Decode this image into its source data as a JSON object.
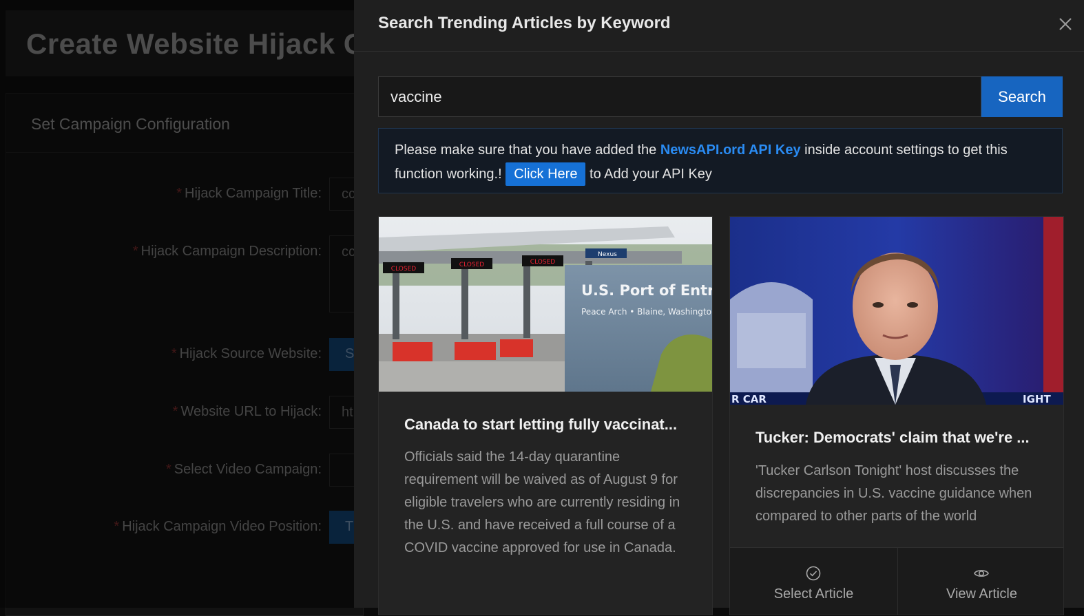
{
  "background": {
    "page_title": "Create Website Hijack Ca",
    "card_title": "Set Campaign Configuration",
    "fields": [
      {
        "label": "Hijack Campaign Title",
        "value": "cc"
      },
      {
        "label": "Hijack Campaign Description",
        "value": "cc"
      },
      {
        "label": "Hijack Source Website",
        "value": "S"
      },
      {
        "label": "Website URL to Hijack",
        "value": "ht"
      },
      {
        "label": "Select Video Campaign",
        "value": ""
      },
      {
        "label": "Hijack Campaign Video Position",
        "value": "T"
      }
    ],
    "required_mark": "*",
    "label_suffix": ":"
  },
  "drawer": {
    "title": "Search Trending Articles by Keyword",
    "close_icon": "close-icon",
    "search": {
      "value": "vaccine",
      "placeholder": "",
      "button_label": "Search"
    },
    "alert": {
      "text_before": "Please make sure that you have added the ",
      "link_text": "NewsAPI.ord API Key",
      "text_middle": " inside account settings to get this function working.! ",
      "button_label": "Click Here",
      "text_after": " to Add your API Key"
    },
    "articles": [
      {
        "title": "Canada to start letting fully vaccinat...",
        "description": "Officials said the 14-day quarantine requirement will be waived as of August 9 for eligible travelers who are currently residing in the U.S. and have received a full course of a COVID vaccine approved for use in Canada.",
        "image_text": {
          "sign_title": "U.S. Port of Entry",
          "sign_sub": "Peace Arch • Blaine, Washingto",
          "closed": "CLOSED",
          "nexus": "Nexus"
        }
      },
      {
        "title": "Tucker: Democrats' claim that we're ...",
        "description": "'Tucker Carlson Tonight' host discusses the discrepancies in U.S. vaccine guidance when compared to other parts of the world",
        "image_text": {
          "left": "R CAR",
          "right": "IGHT"
        },
        "actions": [
          {
            "label": "Select Article",
            "icon": "check-circle-icon"
          },
          {
            "label": "View Article",
            "icon": "eye-icon"
          }
        ]
      }
    ]
  }
}
